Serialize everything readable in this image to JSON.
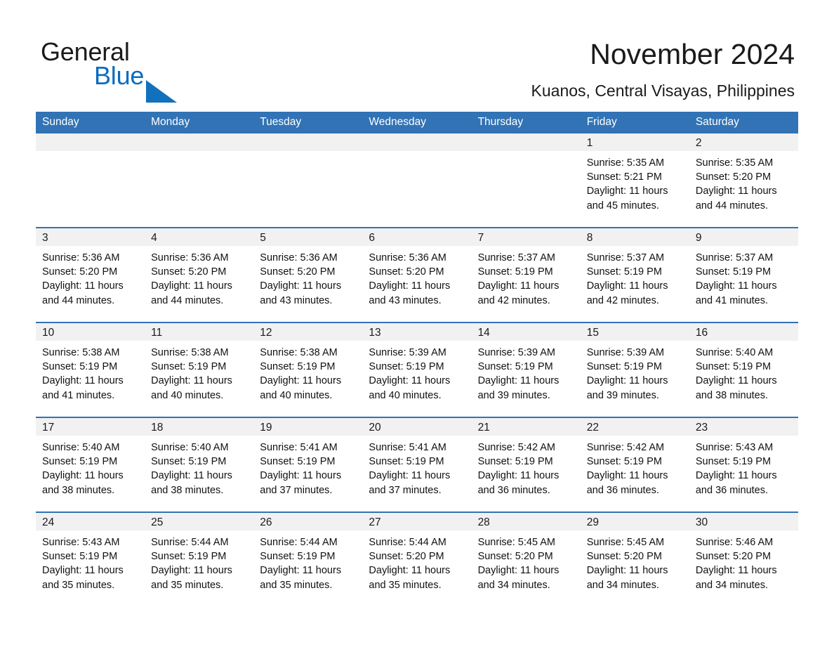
{
  "brand": {
    "name_part1": "General",
    "name_part2": "Blue",
    "triangle_color": "#1271bd",
    "text_color": "#1a1a1a"
  },
  "header": {
    "title": "November 2024",
    "subtitle": "Kuanos, Central Visayas, Philippines"
  },
  "theme": {
    "header_blue": "#3173b5",
    "daynum_band": "#f1f1f1",
    "divider": "#3173b5",
    "page_background": "#ffffff"
  },
  "calendar": {
    "weekday_headers": [
      "Sunday",
      "Monday",
      "Tuesday",
      "Wednesday",
      "Thursday",
      "Friday",
      "Saturday"
    ],
    "weeks": [
      [
        {
          "day": "",
          "empty": true
        },
        {
          "day": "",
          "empty": true
        },
        {
          "day": "",
          "empty": true
        },
        {
          "day": "",
          "empty": true
        },
        {
          "day": "",
          "empty": true
        },
        {
          "day": "1",
          "sunrise": "Sunrise: 5:35 AM",
          "sunset": "Sunset: 5:21 PM",
          "daylight": "Daylight: 11 hours and 45 minutes."
        },
        {
          "day": "2",
          "sunrise": "Sunrise: 5:35 AM",
          "sunset": "Sunset: 5:20 PM",
          "daylight": "Daylight: 11 hours and 44 minutes."
        }
      ],
      [
        {
          "day": "3",
          "sunrise": "Sunrise: 5:36 AM",
          "sunset": "Sunset: 5:20 PM",
          "daylight": "Daylight: 11 hours and 44 minutes."
        },
        {
          "day": "4",
          "sunrise": "Sunrise: 5:36 AM",
          "sunset": "Sunset: 5:20 PM",
          "daylight": "Daylight: 11 hours and 44 minutes."
        },
        {
          "day": "5",
          "sunrise": "Sunrise: 5:36 AM",
          "sunset": "Sunset: 5:20 PM",
          "daylight": "Daylight: 11 hours and 43 minutes."
        },
        {
          "day": "6",
          "sunrise": "Sunrise: 5:36 AM",
          "sunset": "Sunset: 5:20 PM",
          "daylight": "Daylight: 11 hours and 43 minutes."
        },
        {
          "day": "7",
          "sunrise": "Sunrise: 5:37 AM",
          "sunset": "Sunset: 5:19 PM",
          "daylight": "Daylight: 11 hours and 42 minutes."
        },
        {
          "day": "8",
          "sunrise": "Sunrise: 5:37 AM",
          "sunset": "Sunset: 5:19 PM",
          "daylight": "Daylight: 11 hours and 42 minutes."
        },
        {
          "day": "9",
          "sunrise": "Sunrise: 5:37 AM",
          "sunset": "Sunset: 5:19 PM",
          "daylight": "Daylight: 11 hours and 41 minutes."
        }
      ],
      [
        {
          "day": "10",
          "sunrise": "Sunrise: 5:38 AM",
          "sunset": "Sunset: 5:19 PM",
          "daylight": "Daylight: 11 hours and 41 minutes."
        },
        {
          "day": "11",
          "sunrise": "Sunrise: 5:38 AM",
          "sunset": "Sunset: 5:19 PM",
          "daylight": "Daylight: 11 hours and 40 minutes."
        },
        {
          "day": "12",
          "sunrise": "Sunrise: 5:38 AM",
          "sunset": "Sunset: 5:19 PM",
          "daylight": "Daylight: 11 hours and 40 minutes."
        },
        {
          "day": "13",
          "sunrise": "Sunrise: 5:39 AM",
          "sunset": "Sunset: 5:19 PM",
          "daylight": "Daylight: 11 hours and 40 minutes."
        },
        {
          "day": "14",
          "sunrise": "Sunrise: 5:39 AM",
          "sunset": "Sunset: 5:19 PM",
          "daylight": "Daylight: 11 hours and 39 minutes."
        },
        {
          "day": "15",
          "sunrise": "Sunrise: 5:39 AM",
          "sunset": "Sunset: 5:19 PM",
          "daylight": "Daylight: 11 hours and 39 minutes."
        },
        {
          "day": "16",
          "sunrise": "Sunrise: 5:40 AM",
          "sunset": "Sunset: 5:19 PM",
          "daylight": "Daylight: 11 hours and 38 minutes."
        }
      ],
      [
        {
          "day": "17",
          "sunrise": "Sunrise: 5:40 AM",
          "sunset": "Sunset: 5:19 PM",
          "daylight": "Daylight: 11 hours and 38 minutes."
        },
        {
          "day": "18",
          "sunrise": "Sunrise: 5:40 AM",
          "sunset": "Sunset: 5:19 PM",
          "daylight": "Daylight: 11 hours and 38 minutes."
        },
        {
          "day": "19",
          "sunrise": "Sunrise: 5:41 AM",
          "sunset": "Sunset: 5:19 PM",
          "daylight": "Daylight: 11 hours and 37 minutes."
        },
        {
          "day": "20",
          "sunrise": "Sunrise: 5:41 AM",
          "sunset": "Sunset: 5:19 PM",
          "daylight": "Daylight: 11 hours and 37 minutes."
        },
        {
          "day": "21",
          "sunrise": "Sunrise: 5:42 AM",
          "sunset": "Sunset: 5:19 PM",
          "daylight": "Daylight: 11 hours and 36 minutes."
        },
        {
          "day": "22",
          "sunrise": "Sunrise: 5:42 AM",
          "sunset": "Sunset: 5:19 PM",
          "daylight": "Daylight: 11 hours and 36 minutes."
        },
        {
          "day": "23",
          "sunrise": "Sunrise: 5:43 AM",
          "sunset": "Sunset: 5:19 PM",
          "daylight": "Daylight: 11 hours and 36 minutes."
        }
      ],
      [
        {
          "day": "24",
          "sunrise": "Sunrise: 5:43 AM",
          "sunset": "Sunset: 5:19 PM",
          "daylight": "Daylight: 11 hours and 35 minutes."
        },
        {
          "day": "25",
          "sunrise": "Sunrise: 5:44 AM",
          "sunset": "Sunset: 5:19 PM",
          "daylight": "Daylight: 11 hours and 35 minutes."
        },
        {
          "day": "26",
          "sunrise": "Sunrise: 5:44 AM",
          "sunset": "Sunset: 5:19 PM",
          "daylight": "Daylight: 11 hours and 35 minutes."
        },
        {
          "day": "27",
          "sunrise": "Sunrise: 5:44 AM",
          "sunset": "Sunset: 5:20 PM",
          "daylight": "Daylight: 11 hours and 35 minutes."
        },
        {
          "day": "28",
          "sunrise": "Sunrise: 5:45 AM",
          "sunset": "Sunset: 5:20 PM",
          "daylight": "Daylight: 11 hours and 34 minutes."
        },
        {
          "day": "29",
          "sunrise": "Sunrise: 5:45 AM",
          "sunset": "Sunset: 5:20 PM",
          "daylight": "Daylight: 11 hours and 34 minutes."
        },
        {
          "day": "30",
          "sunrise": "Sunrise: 5:46 AM",
          "sunset": "Sunset: 5:20 PM",
          "daylight": "Daylight: 11 hours and 34 minutes."
        }
      ]
    ]
  }
}
